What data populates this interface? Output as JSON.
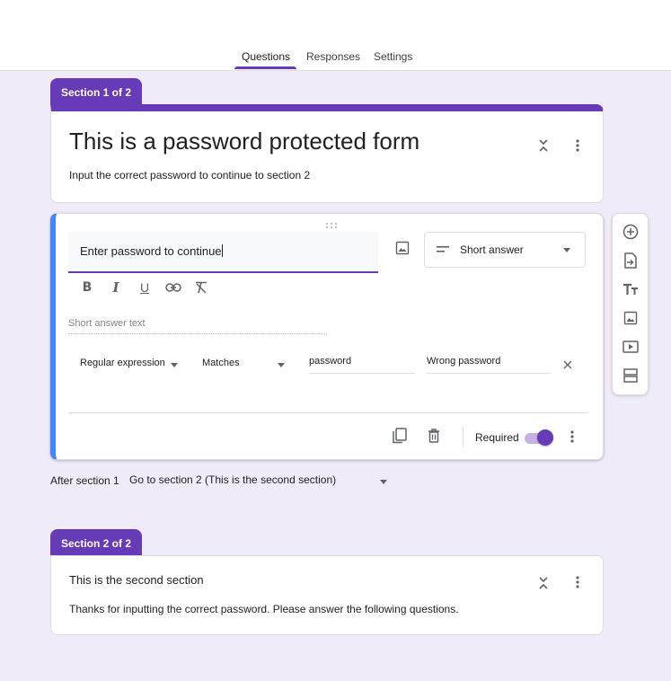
{
  "tabs": [
    {
      "label": "Questions",
      "active": true
    },
    {
      "label": "Responses",
      "active": false
    },
    {
      "label": "Settings",
      "active": false
    }
  ],
  "colors": {
    "accent": "#673ab7",
    "active_border": "#4285f4",
    "background": "#f0ebf8"
  },
  "section1": {
    "tag": "Section 1 of 2",
    "title": "This is a password protected form",
    "description": "Input the correct password to continue to section 2"
  },
  "question": {
    "title": "Enter password to continue",
    "type": "Short answer",
    "answer_placeholder": "Short answer text",
    "formatting": [
      "bold-icon",
      "italic-icon",
      "underline-icon",
      "link-icon",
      "clear-format-icon"
    ],
    "validation": {
      "kind": "Regular expression",
      "condition": "Matches",
      "pattern": "password",
      "error_text": "Wrong password"
    },
    "required_label": "Required",
    "required": true
  },
  "after_section": {
    "label": "After section 1",
    "value": "Go to section 2 (This is the second section)"
  },
  "section2": {
    "tag": "Section 2 of 2",
    "title": "This is the second section",
    "description": "Thanks for inputting the correct password. Please answer the following questions."
  },
  "side_toolbar": [
    "add-question-icon",
    "import-questions-icon",
    "add-title-icon",
    "add-image-icon",
    "add-video-icon",
    "add-section-icon"
  ]
}
